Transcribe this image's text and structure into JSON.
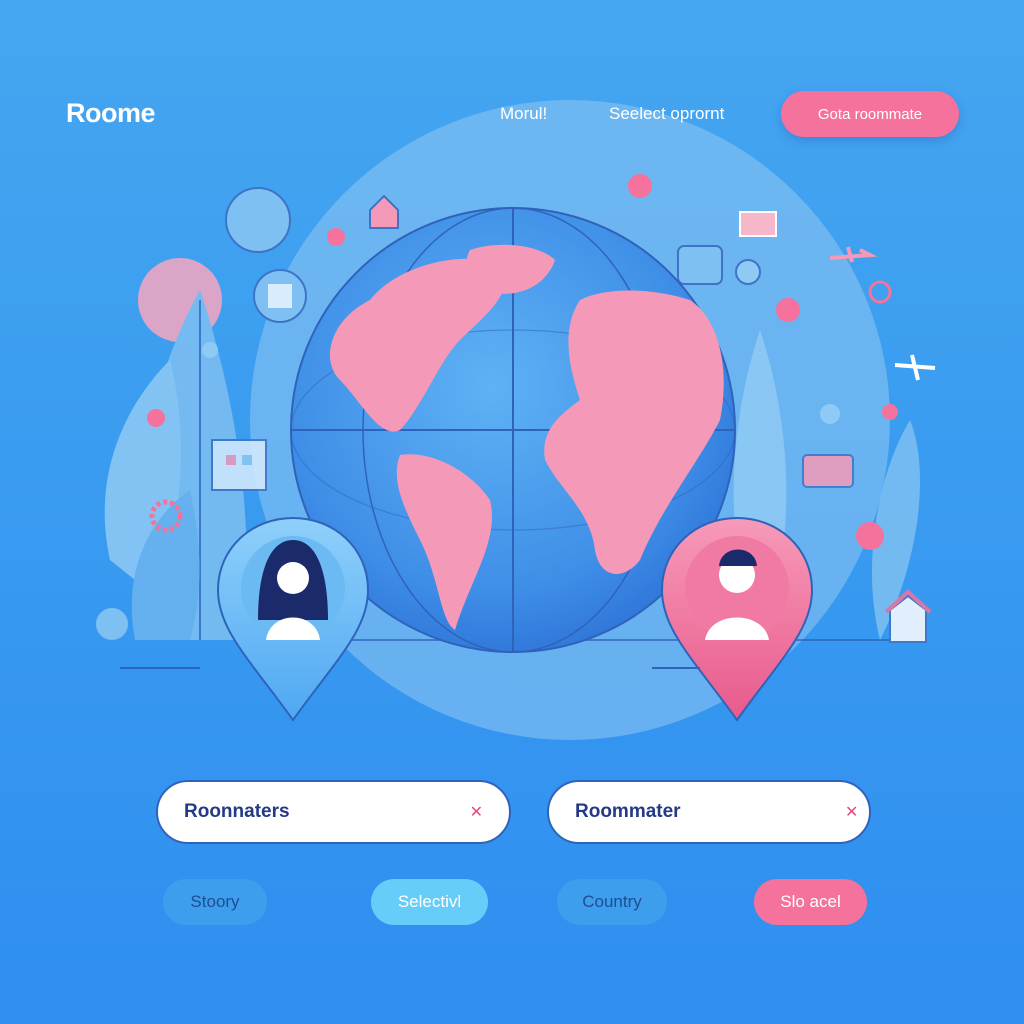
{
  "header": {
    "logo": "Roome",
    "nav": [
      "Morul!",
      "Seelect oprornt"
    ],
    "cta": "Gota roommate"
  },
  "illustration": {
    "globe": "world-globe",
    "pins": [
      "female-avatar-pin",
      "male-avatar-pin"
    ],
    "colors": {
      "background": "#3a9cf0",
      "land": "#f49ab8",
      "ocean": "#3f92e8",
      "accent_pink": "#f4729c",
      "accent_blue": "#66ccf8"
    }
  },
  "search": {
    "field1": {
      "value": "Roonnaters"
    },
    "field2": {
      "value": "Roommater"
    }
  },
  "buttons": [
    "Stoory",
    "Selectivl",
    "Country",
    "Slo acel"
  ]
}
